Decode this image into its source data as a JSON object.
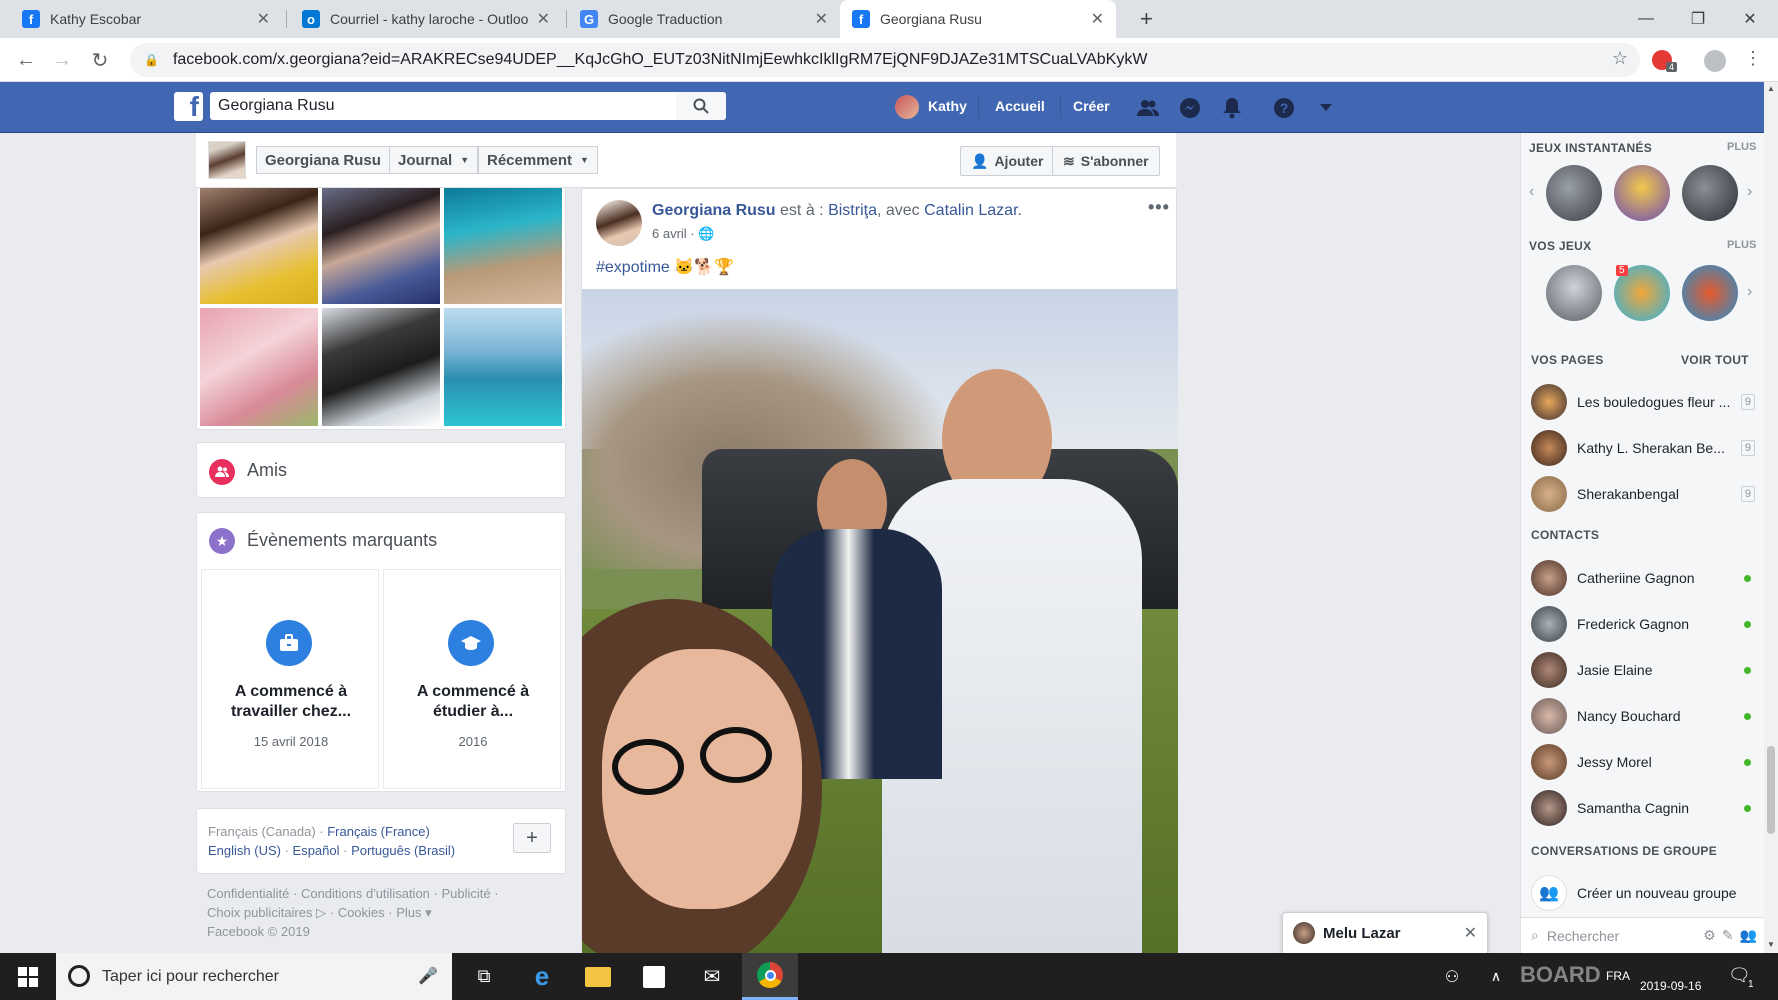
{
  "browser": {
    "tabs": [
      {
        "title": "Kathy Escobar",
        "favicon": "facebook-favicon",
        "color": "#1877f2"
      },
      {
        "title": "Courriel - kathy laroche - Outlook",
        "favicon": "outlook-favicon",
        "color": "#0078d4"
      },
      {
        "title": "Google Traduction",
        "favicon": "google-translate-favicon",
        "color": "#4285f4"
      },
      {
        "title": "Georgiana Rusu",
        "favicon": "facebook-favicon",
        "color": "#1877f2"
      }
    ],
    "url": "facebook.com/x.georgiana?eid=ARAKRECse94UDEP__KqJcGhO_EUTz03NitNImjEewhkcIklIgRM7EjQNF9DJAZe31MTSCuaLVAbKykW",
    "extension_badge": "4"
  },
  "header": {
    "search_value": "Georgiana Rusu",
    "user_name": "Kathy",
    "home_label": "Accueil",
    "create_label": "Créer"
  },
  "profile_bar": {
    "name": "Georgiana Rusu",
    "journal": "Journal",
    "recent": "Récemment",
    "add_friend": "Ajouter",
    "follow": "S'abonner"
  },
  "left": {
    "friends_title": "Amis",
    "events_title": "Évènements marquants",
    "events": [
      {
        "title": "A commencé à travailler chez...",
        "date": "15 avril 2018"
      },
      {
        "title": "A commencé à étudier à...",
        "date": "2016"
      }
    ],
    "languages": {
      "current": "Français (Canada)",
      "links": [
        "Français (France)",
        "English (US)",
        "Español",
        "Português (Brasil)"
      ]
    },
    "footer_links": [
      "Confidentialité",
      "Conditions d'utilisation",
      "Publicité",
      "Choix publicitaires",
      "Cookies",
      "Plus"
    ],
    "copyright": "Facebook © 2019"
  },
  "post": {
    "author": "Georgiana Rusu",
    "is_at": "est à :",
    "place": "Bistriţa",
    "with_word": "avec",
    "tagged": "Catalin Lazar",
    "date": "6 avril",
    "text": "#expotime"
  },
  "right": {
    "instant_games": "JEUX INSTANTANÉS",
    "your_games": "VOS JEUX",
    "more": "PLUS",
    "game_badge": "5",
    "your_pages": "VOS PAGES",
    "see_all": "VOIR TOUT",
    "pages": [
      {
        "name": "Les bouledogues fleur ...",
        "count": "9"
      },
      {
        "name": "Kathy L. Sherakan Be...",
        "count": "9"
      },
      {
        "name": "Sherakanbengal",
        "count": "9"
      }
    ],
    "contacts_title": "CONTACTS",
    "contacts": [
      "Catheriine Gagnon",
      "Frederick Gagnon",
      "Jasie Elaine",
      "Nancy Bouchard",
      "Jessy Morel",
      "Samantha Cagnin"
    ],
    "group_title": "CONVERSATIONS DE GROUPE",
    "new_group": "Créer un nouveau groupe",
    "search_placeholder": "Rechercher"
  },
  "chat": {
    "name": "Melu Lazar"
  },
  "taskbar": {
    "search_placeholder": "Taper ici pour rechercher",
    "lang": "FRA",
    "date": "2019-09-16",
    "notif_count": "1",
    "watermark": "BOARD"
  }
}
